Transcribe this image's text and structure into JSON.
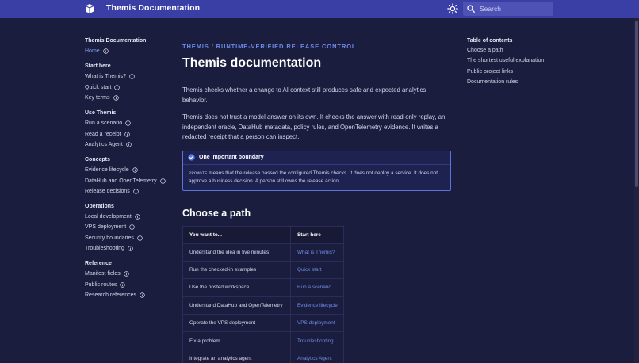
{
  "header": {
    "site_title": "Themis Documentation",
    "search_placeholder": "Search",
    "logo_icon": "box-icon",
    "theme_icon": "sun-icon"
  },
  "sidebar": {
    "title": "Themis Documentation",
    "home": "Home",
    "groups": [
      {
        "heading": "Start here",
        "items": [
          "What is Themis?",
          "Quick start",
          "Key terms"
        ]
      },
      {
        "heading": "Use Themis",
        "items": [
          "Run a scenario",
          "Read a receipt",
          "Analytics Agent"
        ]
      },
      {
        "heading": "Concepts",
        "items": [
          "Evidence lifecycle",
          "DataHub and OpenTelemetry",
          "Release decisions"
        ]
      },
      {
        "heading": "Operations",
        "items": [
          "Local development",
          "VPS deployment",
          "Security boundaries",
          "Troubleshooting"
        ]
      },
      {
        "heading": "Reference",
        "items": [
          "Manifest fields",
          "Public routes",
          "Research references"
        ]
      }
    ]
  },
  "main": {
    "eyebrow": "THEMIS / RUNTIME-VERIFIED RELEASE CONTROL",
    "title": "Themis documentation",
    "intro": "Themis checks whether a change to AI context still produces safe and expected analytics behavior.",
    "detail": "Themis does not trust a model answer on its own. It checks the answer with read-only replay, an independent oracle, DataHub metadata, policy rules, and OpenTelemetry evidence. It writes a redacted receipt that a person can inspect.",
    "callout": {
      "title": "One important boundary",
      "code": "PROMOTE",
      "text": " means that the release passed the configured Themis checks. It does not deploy a service. It does not approve a business decision. A person still owns the release action."
    },
    "path_heading": "Choose a path",
    "table": {
      "headers": [
        "You want to...",
        "Start here"
      ],
      "rows": [
        [
          "Understand the idea in five minutes",
          "What is Themis?"
        ],
        [
          "Run the checked-in examples",
          "Quick start"
        ],
        [
          "Use the hosted workspace",
          "Run a scenario"
        ],
        [
          "Understand DataHub and OpenTelemetry",
          "Evidence lifecycle"
        ],
        [
          "Operate the VPS deployment",
          "VPS deployment"
        ],
        [
          "Fix a problem",
          "Troubleshooting"
        ],
        [
          "Integrate an analytics agent",
          "Analytics Agent"
        ]
      ]
    }
  },
  "toc": {
    "title": "Table of contents",
    "items": [
      "Choose a path",
      "The shortest useful explanation",
      "Public project links",
      "Documentation rules"
    ]
  },
  "colors": {
    "header_bg": "#3a3fa6",
    "page_bg": "#1b1d3e",
    "accent": "#6f8de6"
  }
}
